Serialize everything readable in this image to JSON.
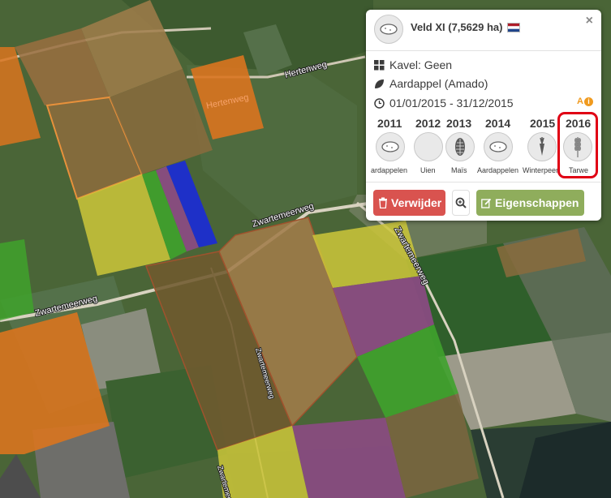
{
  "map": {
    "roads": {
      "hertenweg_small": "Hertenweg",
      "hertenweg_field": "Hertenweg",
      "zwartemeerweg_mid": "Zwartemeerweg",
      "zwartemeerweg_left": "Zwartemeerweg",
      "zwartemeerweg_right": "Zwartemeerweg",
      "zwartemeerweg_diag": "Zwartemeerweg",
      "zwartemeerweg_diag2": "Zwartemeerweg",
      "zwartemeerweg_bottom": "Zwartemeerweg"
    },
    "colors": {
      "orange": "#d9741f",
      "brown": "#8a6b3d",
      "tan": "#a07c4a",
      "yellow": "#cdc73a",
      "green": "#3fa22c",
      "purple": "#8d4a85",
      "blue": "#1a2ad8",
      "olive": "#6f6a3a"
    }
  },
  "popup": {
    "title": "Veld XI (7,5629 ha)",
    "close_label": "×",
    "kavel": "Kavel: Geen",
    "gewas": "Aardappel (Amado)",
    "periode": "01/01/2015 - 31/12/2015",
    "ai_badge": "A",
    "ai_badge_dot": "i",
    "history": [
      {
        "year": "2011",
        "label": "ardappelen",
        "icon": "potato-icon"
      },
      {
        "year": "2012",
        "label": "Uien",
        "icon": "onion-icon"
      },
      {
        "year": "2013",
        "label": "Maïs",
        "icon": "corn-icon"
      },
      {
        "year": "2014",
        "label": "Aardappelen",
        "icon": "potato-icon"
      },
      {
        "year": "2015",
        "label": "Winterpeen",
        "icon": "carrot-icon"
      },
      {
        "year": "2016",
        "label": "Tarwe",
        "icon": "wheat-icon"
      }
    ],
    "buttons": {
      "delete": "Verwijder",
      "properties": "Eigenschappen"
    }
  }
}
